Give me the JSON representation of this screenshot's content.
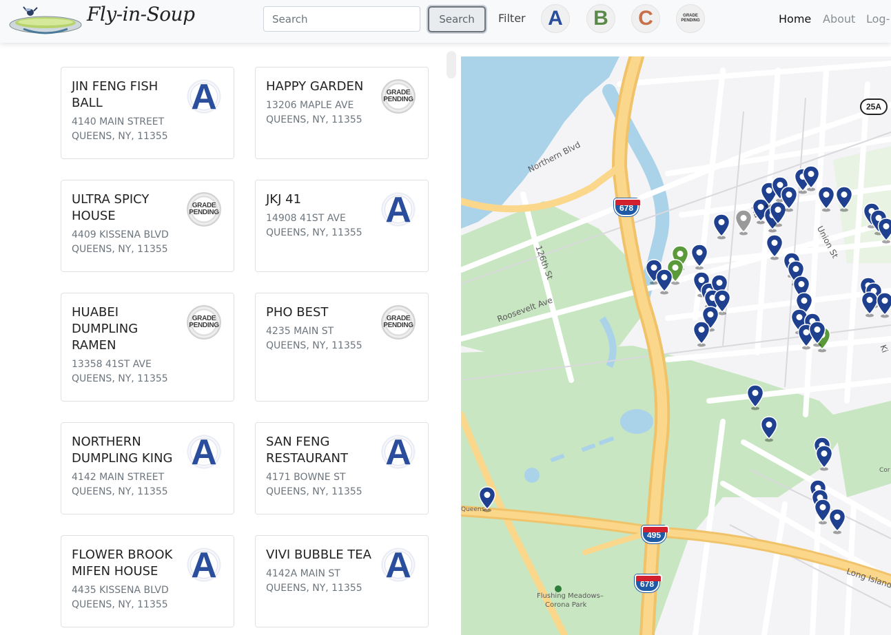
{
  "navbar": {
    "brand": "Fly-in-Soup",
    "search_placeholder": "Search",
    "search_button": "Search",
    "filter_label": "Filter",
    "filters": [
      {
        "glyph": "A",
        "color": "#2a4e9c"
      },
      {
        "glyph": "B",
        "color": "#5a8a4a"
      },
      {
        "glyph": "C",
        "color": "#c8704a"
      },
      {
        "glyph": "GRADE PENDING",
        "color": "#333333"
      }
    ],
    "links": [
      {
        "label": "Home",
        "active": true
      },
      {
        "label": "About",
        "active": false
      },
      {
        "label": "Log-",
        "active": false
      }
    ]
  },
  "restaurants": [
    {
      "name": "JIN FENG FISH BALL",
      "address": "4140 MAIN STREET",
      "city": "QUEENS, NY, 11355",
      "grade": "A"
    },
    {
      "name": "HAPPY GARDEN",
      "address": "13206 MAPLE AVE",
      "city": "QUEENS, NY, 11355",
      "grade": "GRADE PENDING"
    },
    {
      "name": "ULTRA SPICY HOUSE",
      "address": "4409 KISSENA BLVD",
      "city": "QUEENS, NY, 11355",
      "grade": "GRADE PENDING"
    },
    {
      "name": "JKJ 41",
      "address": "14908 41ST AVE",
      "city": "QUEENS, NY, 11355",
      "grade": "A"
    },
    {
      "name": "HUABEI DUMPLING RAMEN",
      "address": "13358 41ST AVE",
      "city": "QUEENS, NY, 11355",
      "grade": "GRADE PENDING"
    },
    {
      "name": "PHO BEST",
      "address": "4235 MAIN ST",
      "city": "QUEENS, NY, 11355",
      "grade": "GRADE PENDING"
    },
    {
      "name": "NORTHERN DUMPLING KING",
      "address": "4142 MAIN STREET",
      "city": "QUEENS, NY, 11355",
      "grade": "A"
    },
    {
      "name": "SAN FENG RESTAURANT",
      "address": "4171 BOWNE ST",
      "city": "QUEENS, NY, 11355",
      "grade": "A"
    },
    {
      "name": "FLOWER BROOK MIFEN HOUSE",
      "address": "4435 KISSENA BLVD",
      "city": "QUEENS, NY, 11355",
      "grade": "A"
    },
    {
      "name": "VIVI BUBBLE TEA",
      "address": "4142A MAIN ST",
      "city": "QUEENS, NY, 11355",
      "grade": "A"
    }
  ],
  "map": {
    "street_labels": [
      "Northern Blvd",
      "126th St",
      "Roosevelt Ave",
      "Union St",
      "Long Island",
      "Flushing Meadows–",
      "Corona Park",
      "Queens",
      "Ma",
      "Ki",
      "Cor"
    ],
    "route_shields": [
      "678",
      "495",
      "678"
    ],
    "route_oval": "25A",
    "marker_colors": {
      "a": "#1f3f8f",
      "b": "#5b9a3a",
      "pending": "#9a9a9a"
    }
  }
}
